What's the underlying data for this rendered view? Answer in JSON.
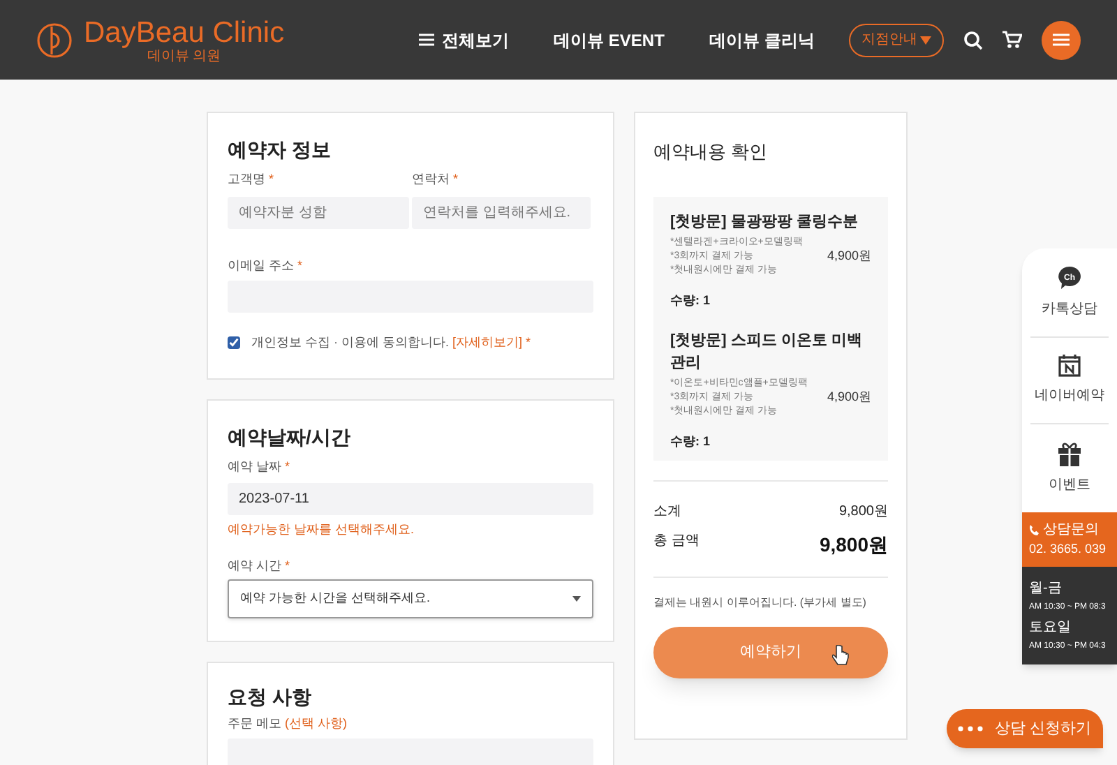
{
  "header": {
    "logo": "DayBeau Clinic",
    "logo_sub": "데이뷰 의원",
    "nav": [
      {
        "label": "전체보기",
        "kind": "menu"
      },
      {
        "label": "데이뷰 EVENT",
        "kind": "link"
      },
      {
        "label": "데이뷰 클리닉",
        "kind": "link"
      }
    ],
    "branch_select": "지점안내"
  },
  "booker": {
    "title": "예약자 정보",
    "name_label": "고객명",
    "name_placeholder": "예약자분 성함",
    "phone_label": "연락처",
    "phone_placeholder": "연락처를 입력해주세요.",
    "email_label": "이메일 주소",
    "required": "*",
    "consent": {
      "text": "개인정보 수집 · 이용에 동의합니다.",
      "link": "[자세히보기]",
      "checked": true
    }
  },
  "schedule": {
    "title": "예약날짜/시간",
    "date_label": "예약 날짜",
    "date_value": "2023-07-11",
    "date_hint": "예약가능한 날짜를 선택해주세요.",
    "time_label": "예약 시간",
    "time_placeholder": "예약 가능한 시간을 선택해주세요."
  },
  "request": {
    "title": "요청 사항",
    "memo_label": "주문 메모",
    "memo_optional": "(선택 사항)"
  },
  "summary": {
    "title": "예약내용 확인",
    "items": [
      {
        "name": "[첫방문] 물광팡팡 쿨링수분",
        "notes": [
          "*센텔라겐+크라이오+모델링팩",
          "*3회까지 결제 가능",
          "*첫내원시에만 결제 가능"
        ],
        "price": "4,900원",
        "qty": "수량: 1"
      },
      {
        "name": "[첫방문] 스피드 이온토 미백관리",
        "notes": [
          "*이온토+비타민c앰플+모델링팩",
          "*3회까지 결제 가능",
          "*첫내원시에만 결제 가능"
        ],
        "price": "4,900원",
        "qty": "수량: 1"
      }
    ],
    "subtotal_label": "소계",
    "subtotal": "9,800원",
    "total_label": "총 금액",
    "total": "9,800원",
    "note": "결제는 내원시 이루어집니다. (부가세 별도)",
    "button": "예약하기"
  },
  "quick_menu": {
    "items": [
      {
        "label": "카톡상담",
        "kind": "chat",
        "icon_text": "Ch"
      },
      {
        "label": "네이버예약",
        "kind": "calendar"
      },
      {
        "label": "이벤트",
        "kind": "gift"
      }
    ],
    "phone_label": "상담문의",
    "phone": "02. 3665. 039",
    "hours": [
      {
        "day": "월-금",
        "time": "AM 10:30 ~ PM 08:3"
      },
      {
        "day": "토요일",
        "time": "AM 10:30 ~ PM 04:3"
      }
    ]
  },
  "consult_button": "상담 신청하기"
}
